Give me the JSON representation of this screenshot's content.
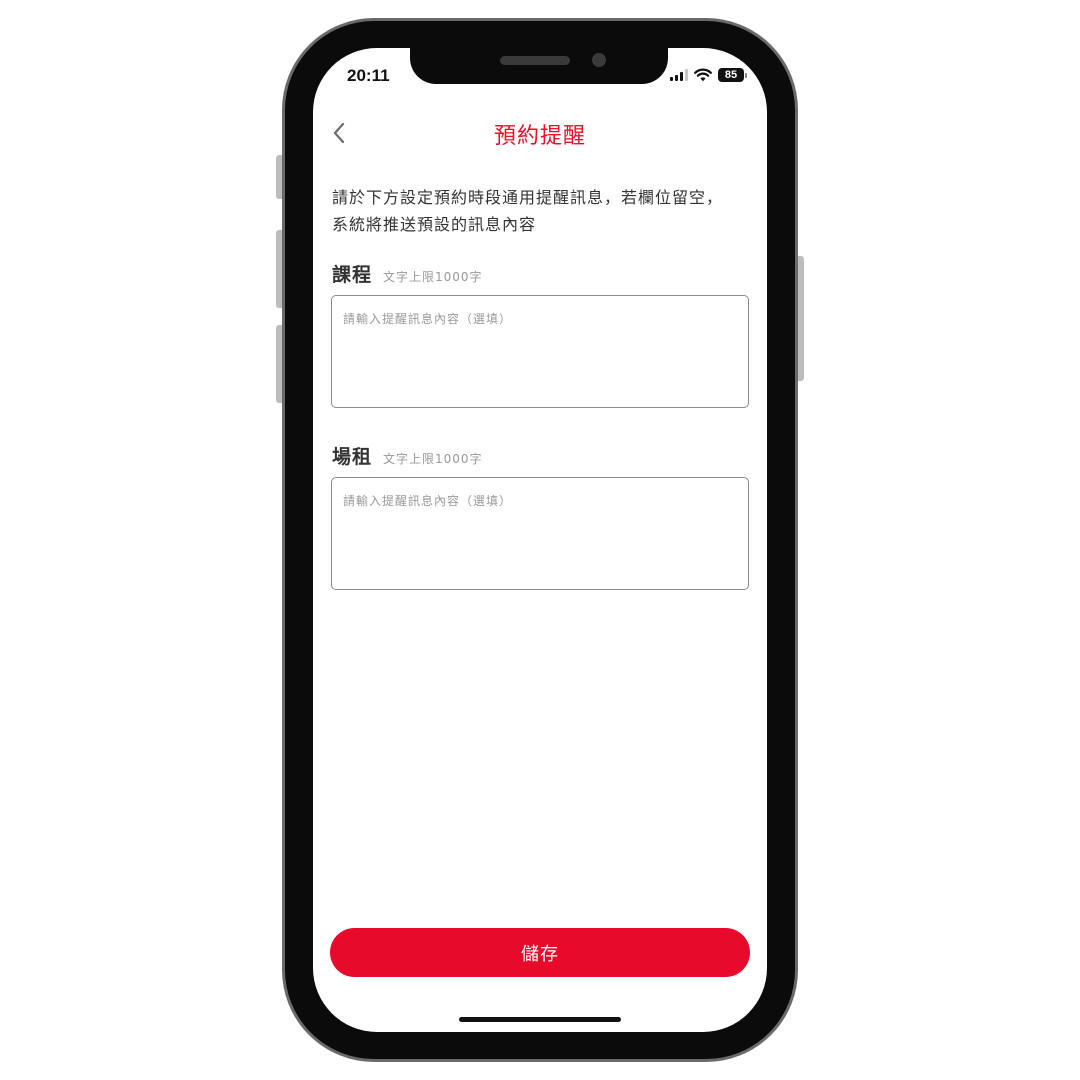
{
  "status_bar": {
    "time": "20:11",
    "battery": "85",
    "icons": [
      "signal-icon",
      "wifi-icon",
      "battery-icon"
    ]
  },
  "nav": {
    "title": "預約提醒",
    "back_icon": "chevron-left-icon",
    "title_color": "#e8102a"
  },
  "intro": {
    "text": "請於下方設定預約時段通用提醒訊息，若欄位留空，系統將推送預設的訊息內容"
  },
  "sections": [
    {
      "label": "課程",
      "hint": "文字上限1000字",
      "value": "",
      "placeholder": "請輸入提醒訊息內容（選填）"
    },
    {
      "label": "場租",
      "hint": "文字上限1000字",
      "value": "",
      "placeholder": "請輸入提醒訊息內容（選填）"
    }
  ],
  "footer": {
    "save_label": "儲存",
    "button_color": "#e80a2a"
  }
}
